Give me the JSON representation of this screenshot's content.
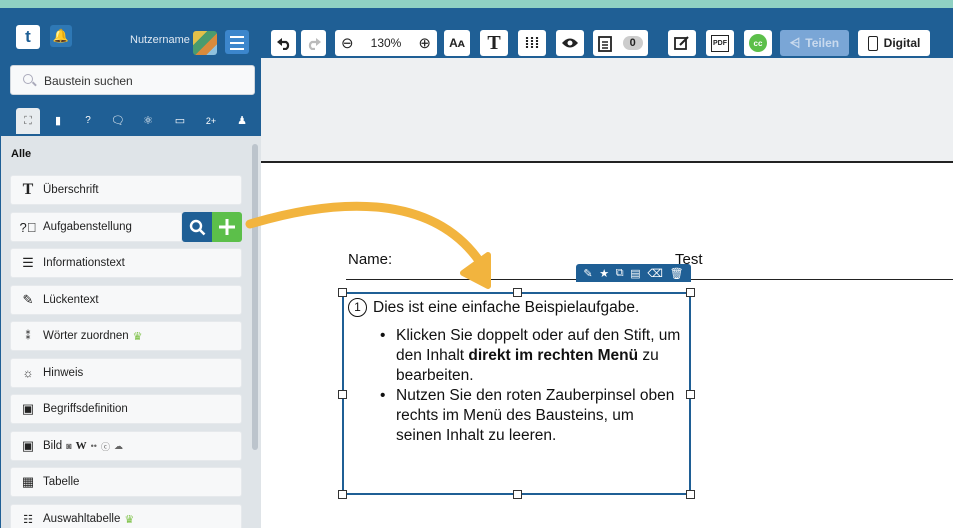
{
  "header": {
    "username": "Nutzername",
    "zoom": "130%",
    "clipboard_count": "0",
    "share_label": "Teilen",
    "mode_label": "Digital"
  },
  "sidebar": {
    "search_placeholder": "Baustein suchen",
    "section_label": "Alle",
    "items": [
      {
        "label": "Überschrift",
        "icon": "heading-t-icon"
      },
      {
        "label": "Aufgabenstellung",
        "icon": "question-circle-icon"
      },
      {
        "label": "Informationstext",
        "icon": "text-lines-icon"
      },
      {
        "label": "Lückentext",
        "icon": "edit-box-icon"
      },
      {
        "label": "Wörter zuordnen",
        "icon": "matching-icon"
      },
      {
        "label": "Hinweis",
        "icon": "lightbulb-icon"
      },
      {
        "label": "Begriffsdefinition",
        "icon": "bookmark-icon"
      },
      {
        "label": "Bild",
        "icon": "image-icon"
      },
      {
        "label": "Tabelle",
        "icon": "table-icon"
      },
      {
        "label": "Auswahltabelle",
        "icon": "choice-table-icon"
      }
    ]
  },
  "canvas": {
    "name_label": "Name:",
    "title": "Test",
    "task_number": "1",
    "task_intro": "Dies ist eine einfache Beispielaufgabe.",
    "bullet1_pre": "Klicken Sie doppelt oder auf den Stift, um den Inhalt ",
    "bullet1_bold": "direkt im rechten Menü",
    "bullet1_post": " zu bearbeiten.",
    "bullet2": "Nutzen Sie den roten Zauberpinsel oben rechts im Menü des Bausteins, um seinen Inhalt zu leeren."
  },
  "colors": {
    "primary": "#1f5f95",
    "accent_green": "#5cbf4a",
    "arrow": "#f2b43e"
  }
}
